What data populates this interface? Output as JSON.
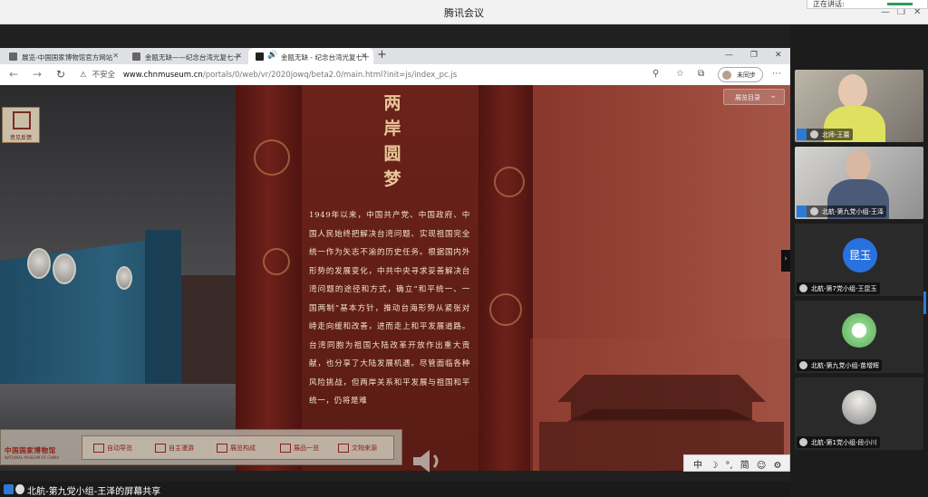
{
  "app": {
    "title": "腾讯会议",
    "notification": "正在讲话:"
  },
  "browser": {
    "tabs": [
      {
        "label": "展览-中国国家博物馆官方网站",
        "active": false
      },
      {
        "label": "金瓯无缺——纪念台湾光复七十",
        "active": false
      },
      {
        "label": "金瓯无缺 - 纪念台湾光复七十",
        "active": true
      }
    ],
    "security_label": "不安全",
    "url_host": "www.chnmuseum.cn",
    "url_path": "/portals/0/web/vr/2020jowq/beta2.0/main.html?init=js/index_pc.js",
    "sync_label": "未同步"
  },
  "museum": {
    "heading": "两岸圆梦",
    "body": "1949年以来，中国共产党、中国政府、中国人民始终把解决台湾问题、实现祖国完全统一作为矢志不渝的历史任务。根据国内外形势的发展变化，中共中央寻求妥善解决台湾问题的途径和方式，确立“和平统一、一国两制”基本方针，推动台海形势从紧张对峙走向缓和改善，进而走上和平发展道路。台湾同胞为祖国大陆改革开放作出重大贡献，也分享了大陆发展机遇。尽管面临各种风险挑战，但两岸关系和平发展与祖国和平统一，仍将是难",
    "dropdown_label": "展览目录",
    "feedback_label": "意见反馈",
    "logo_text": "中国国家博物馆",
    "logo_sub": "NATIONAL MUSEUM OF CHINA",
    "nav_items": [
      "自动导览",
      "自主漫游",
      "展览构成",
      "展品一览",
      "文物来源"
    ]
  },
  "ime": {
    "items": [
      "中",
      "☽",
      "°,",
      "简",
      "☺",
      "⚙"
    ]
  },
  "share_bar": {
    "label": "北航-第九党小组-王泽的屏幕共享"
  },
  "participants": [
    {
      "name": "北师-王蕾",
      "type": "video"
    },
    {
      "name": "北航-第九党小组-王泽",
      "type": "video"
    },
    {
      "name": "北航-第7党小组-王昆玉",
      "type": "avatar",
      "avatar_text": "昆玉"
    },
    {
      "name": "北航-第九党小组-苗增辉",
      "type": "avatar"
    },
    {
      "name": "北航-第1党小组-段小川",
      "type": "avatar"
    }
  ]
}
